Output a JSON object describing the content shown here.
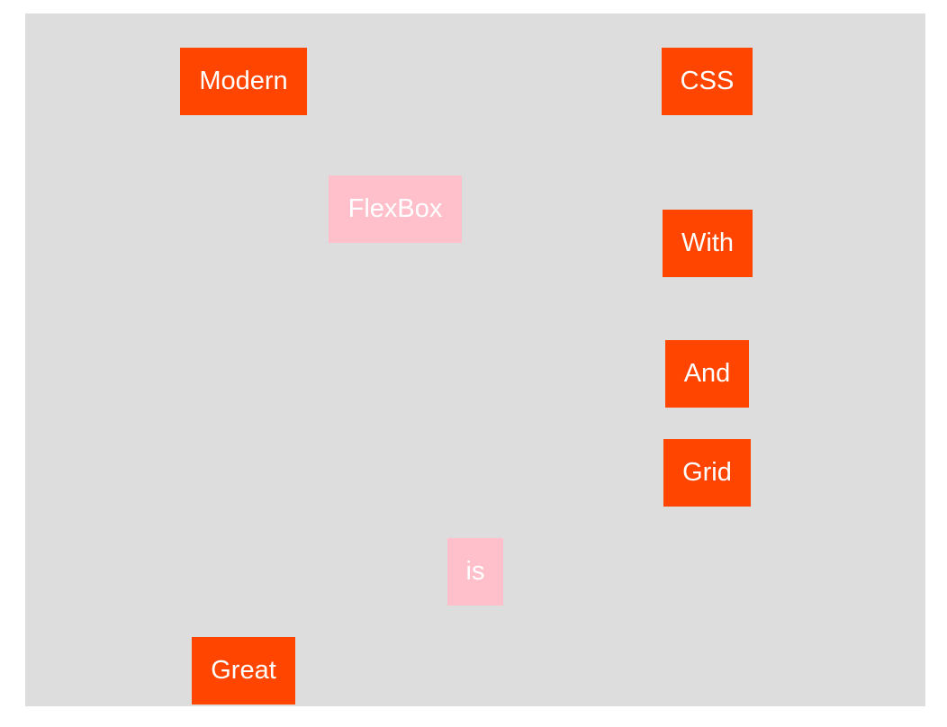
{
  "words": {
    "modern": "Modern",
    "css": "CSS",
    "flexbox": "FlexBox",
    "with": "With",
    "and": "And",
    "grid": "Grid",
    "is": "is",
    "great": "Great"
  },
  "colors": {
    "background": "#dddddd",
    "primary_box": "#ff4500",
    "secondary_box": "#ffc0cb",
    "text": "#ffffff"
  }
}
